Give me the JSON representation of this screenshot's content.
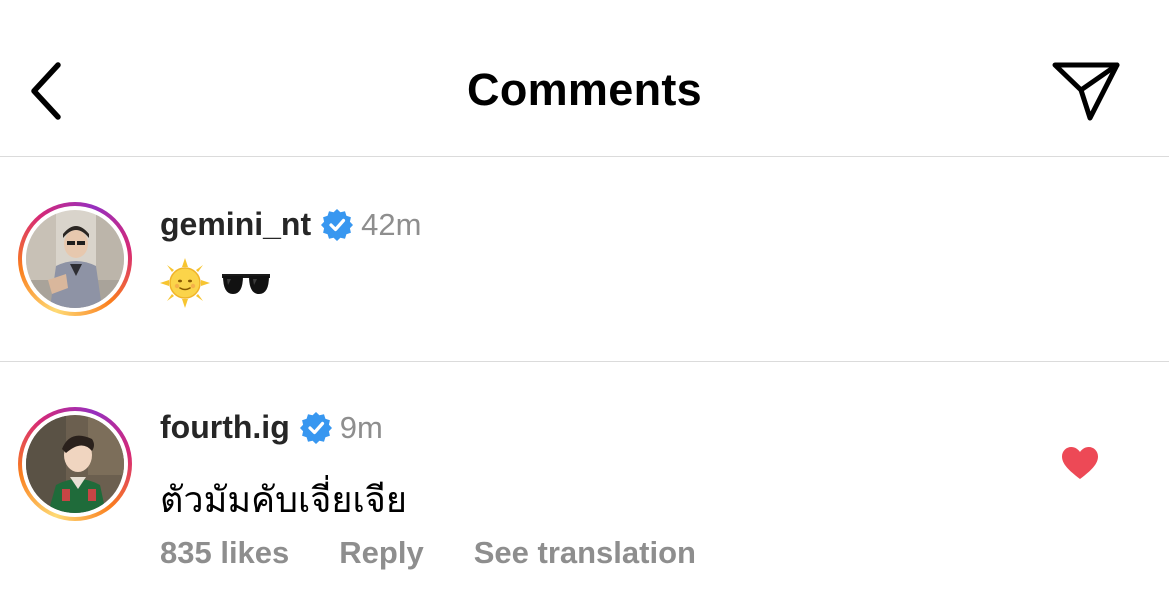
{
  "header": {
    "title": "Comments",
    "back_icon": "chevron-left-icon",
    "share_icon": "send-icon"
  },
  "comments": [
    {
      "username": "gemini_nt",
      "verified": true,
      "time": "42m",
      "text": "🌞🕶",
      "emojis": [
        "sun-with-face",
        "sunglasses"
      ],
      "liked": false
    },
    {
      "username": "fourth.ig",
      "verified": true,
      "time": "9m",
      "text": "ตัวมัมคับเจี่ยเจีย",
      "liked": true,
      "actions": {
        "likes": "835 likes",
        "reply": "Reply",
        "translate": "See translation"
      }
    }
  ],
  "colors": {
    "verified": "#3897f0",
    "heart": "#ed4956",
    "secondary_text": "#8e8e8e",
    "divider": "#dbdbdb"
  }
}
